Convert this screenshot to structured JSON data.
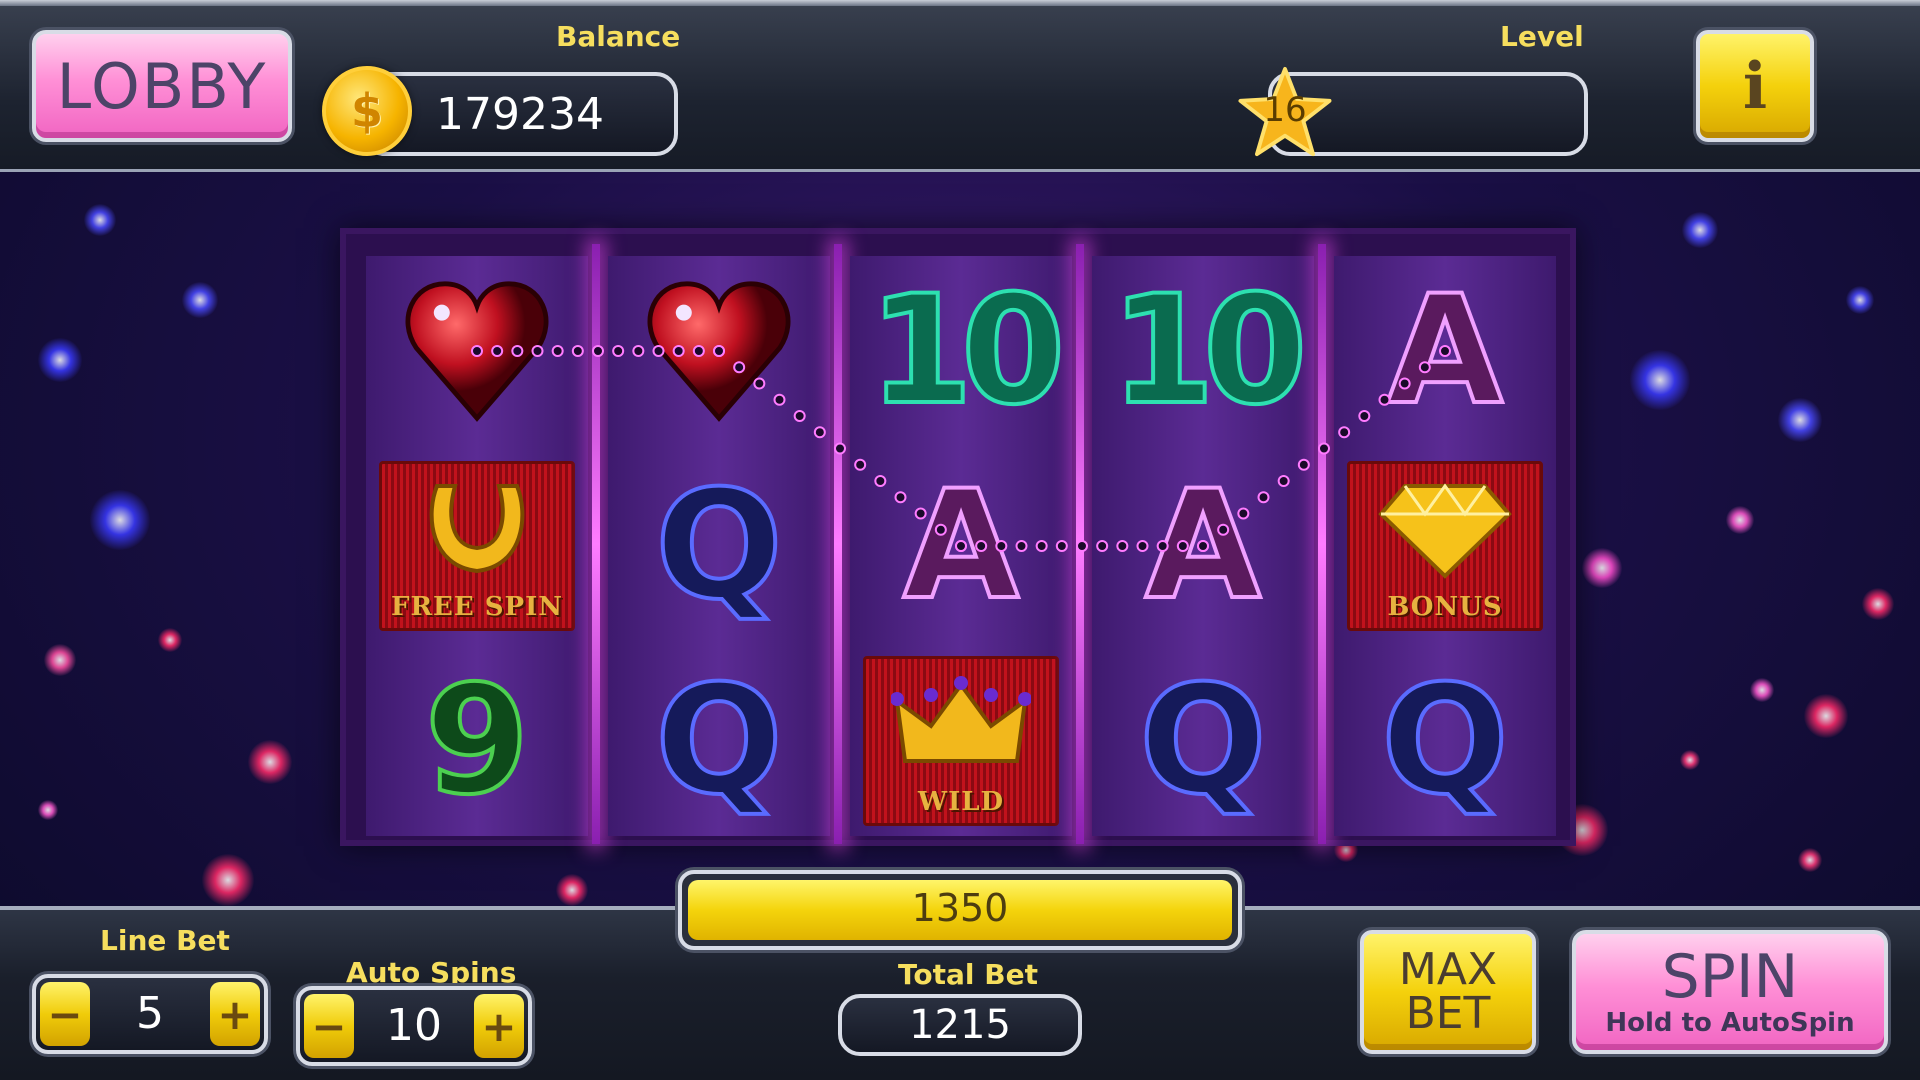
{
  "header": {
    "lobby_label": "LOBBY",
    "balance_label": "Balance",
    "balance_value": "179234",
    "coin_symbol": "$",
    "level_label": "Level",
    "level_value": "16",
    "info_label": "i"
  },
  "reels": {
    "symbols": [
      [
        "heart",
        "free-spin",
        "nine"
      ],
      [
        "heart",
        "queen",
        "queen"
      ],
      [
        "ten",
        "ace",
        "wild"
      ],
      [
        "ten",
        "ace",
        "queen"
      ],
      [
        "ace",
        "bonus",
        "queen"
      ]
    ],
    "glyphs": {
      "ten": "10",
      "ace": "A",
      "queen": "Q",
      "nine": "9"
    },
    "tile_labels": {
      "free_spin": "FREE SPIN",
      "wild": "WILD",
      "bonus": "BONUS"
    },
    "winning_payline": [
      0,
      0,
      1,
      1,
      0
    ]
  },
  "win_meter": {
    "value": "1350",
    "fill_fraction": 1.0
  },
  "controls": {
    "line_bet_label": "Line Bet",
    "line_bet_value": "5",
    "auto_spins_label": "Auto Spins",
    "auto_spins_value": "10",
    "minus": "−",
    "plus": "+",
    "total_bet_label": "Total Bet",
    "total_bet_value": "1215",
    "max_bet_label": "MAX BET",
    "spin_label": "SPIN",
    "spin_sub_label": "Hold to AutoSpin"
  },
  "colors": {
    "label_yellow": "#f6de5e",
    "button_pink": "#ff8fd6",
    "button_yellow": "#f4d10c",
    "reel_purple": "#5b2b94",
    "tile_red": "#c1121c"
  }
}
